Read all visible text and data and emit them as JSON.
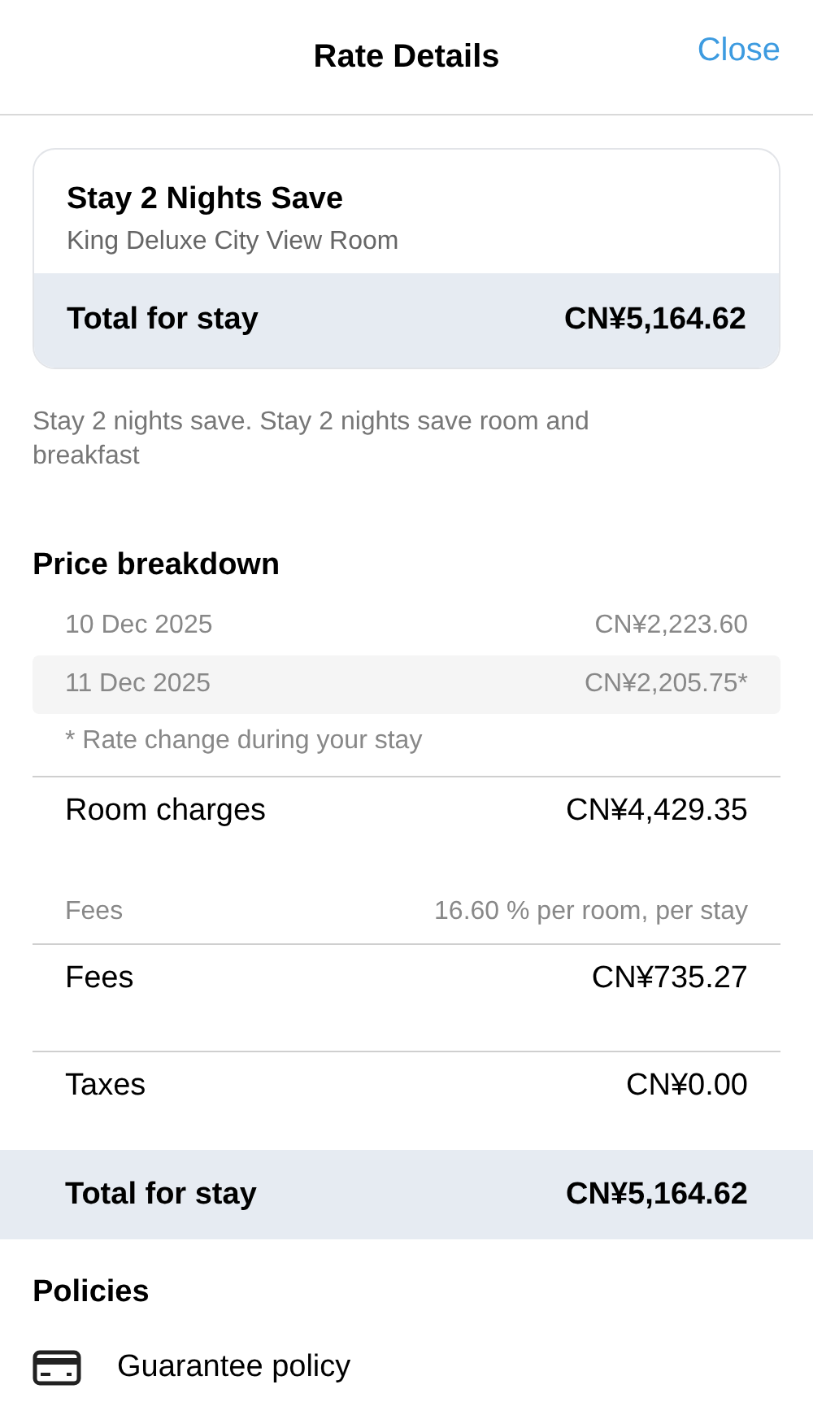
{
  "header": {
    "title": "Rate Details",
    "close": "Close"
  },
  "rate_card": {
    "name": "Stay 2 Nights Save",
    "room": "King Deluxe City View Room",
    "total_label": "Total for stay",
    "total_amount": "CN¥5,164.62"
  },
  "description": "Stay 2 nights save. Stay 2 nights save room and breakfast",
  "price_breakdown": {
    "title": "Price breakdown",
    "nights": [
      {
        "date": "10 Dec 2025",
        "amount": "CN¥2,223.60"
      },
      {
        "date": "11 Dec 2025",
        "amount": "CN¥2,205.75*"
      }
    ],
    "note": "* Rate change during your stay",
    "lines": [
      {
        "kind": "charge",
        "label": "Room charges",
        "amount": "CN¥4,429.35",
        "divider_above": true
      },
      {
        "kind": "detail",
        "label": "Fees",
        "amount": "16.60 % per room, per stay",
        "divider_above": false
      },
      {
        "kind": "charge",
        "label": "Fees",
        "amount": "CN¥735.27",
        "divider_above": true
      },
      {
        "kind": "charge",
        "label": "Taxes",
        "amount": "CN¥0.00",
        "divider_above": true
      }
    ],
    "total_label": "Total for stay",
    "total_amount": "CN¥5,164.62"
  },
  "policies": {
    "title": "Policies",
    "items": [
      {
        "label": "Guarantee policy"
      }
    ]
  }
}
